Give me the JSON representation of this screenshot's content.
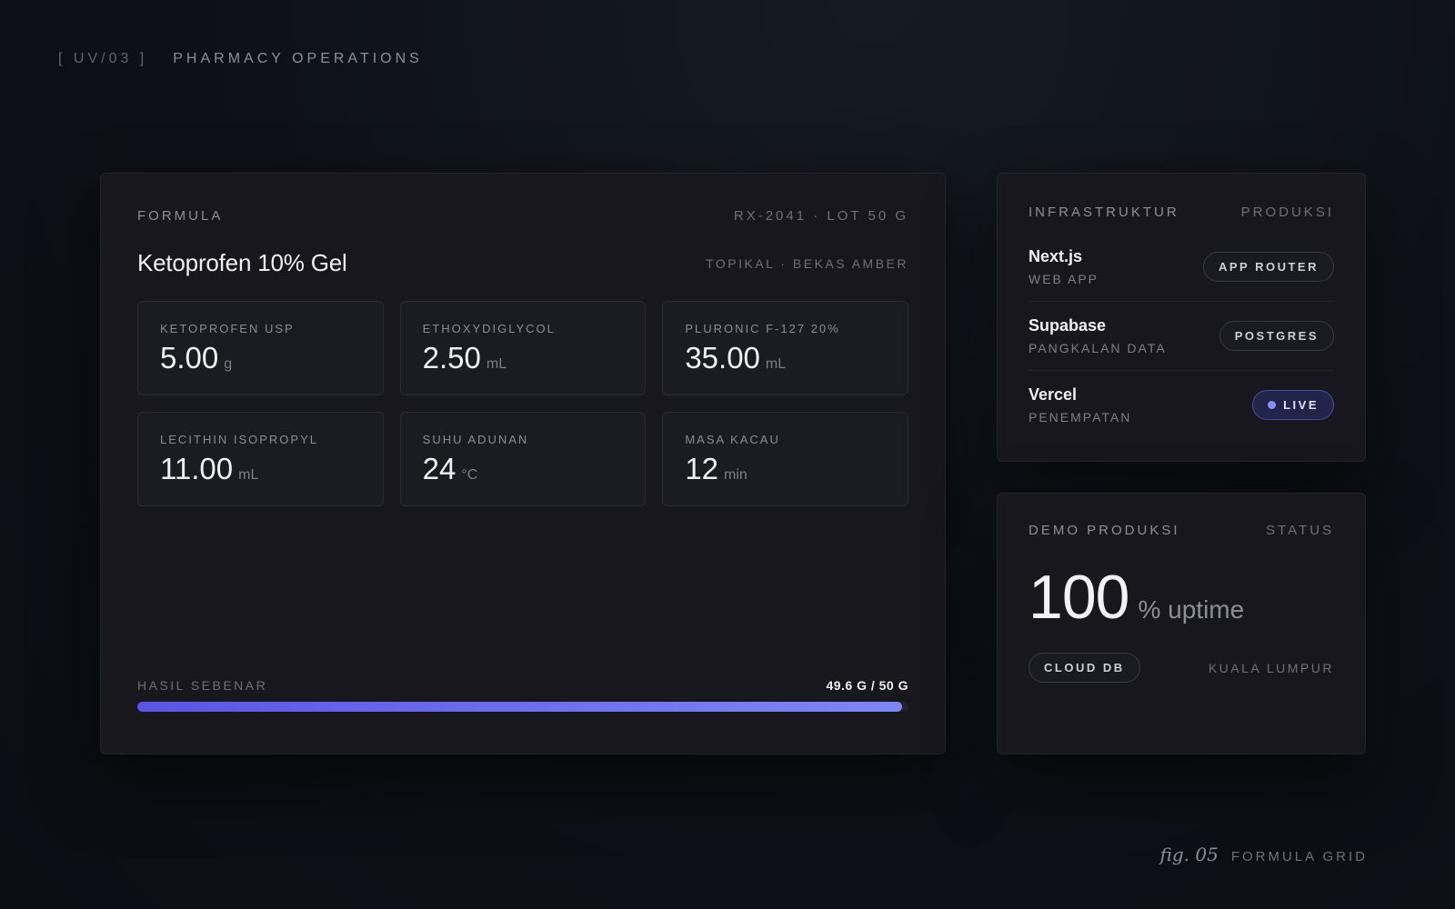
{
  "header": {
    "code": "[ UV/03 ]",
    "title": "PHARMACY OPERATIONS"
  },
  "formula": {
    "section_label": "FORMULA",
    "ref": "RX-2041 · LOT 50 G",
    "name": "Ketoprofen 10% Gel",
    "meta": "TOPIKAL · BEKAS AMBER",
    "ingredients": [
      {
        "label": "KETOPROFEN USP",
        "value": "5.00",
        "unit": "g"
      },
      {
        "label": "ETHOXYDIGLYCOL",
        "value": "2.50",
        "unit": "mL"
      },
      {
        "label": "PLURONIC F-127 20%",
        "value": "35.00",
        "unit": "mL"
      },
      {
        "label": "LECITHIN ISOPROPYL",
        "value": "11.00",
        "unit": "mL"
      },
      {
        "label": "SUHU ADUNAN",
        "value": "24",
        "unit": "°C"
      },
      {
        "label": "MASA KACAU",
        "value": "12",
        "unit": "min"
      }
    ],
    "yield": {
      "label": "HASIL SEBENAR",
      "value_text": "49.6 G / 50 G",
      "fraction": 0.992
    }
  },
  "infra": {
    "title": "INFRASTRUKTUR",
    "env": "PRODUKSI",
    "items": [
      {
        "name": "Next.js",
        "sub": "WEB APP",
        "tag": "APP ROUTER"
      },
      {
        "name": "Supabase",
        "sub": "PANGKALAN DATA",
        "tag": "POSTGRES"
      },
      {
        "name": "Vercel",
        "sub": "PENEMPATAN",
        "tag": "LIVE"
      }
    ]
  },
  "demo": {
    "title": "DEMO PRODUKSI",
    "status_label": "STATUS",
    "uptime_value": "100",
    "uptime_unit": "% uptime",
    "tag": "CLOUD DB",
    "location": "KUALA LUMPUR"
  },
  "figure": {
    "number": "fig. 05",
    "label": "FORMULA GRID"
  },
  "colors": {
    "accent_start": "#5a55e6",
    "accent_end": "#7f86f6",
    "live_dot": "#8a8ff8"
  }
}
